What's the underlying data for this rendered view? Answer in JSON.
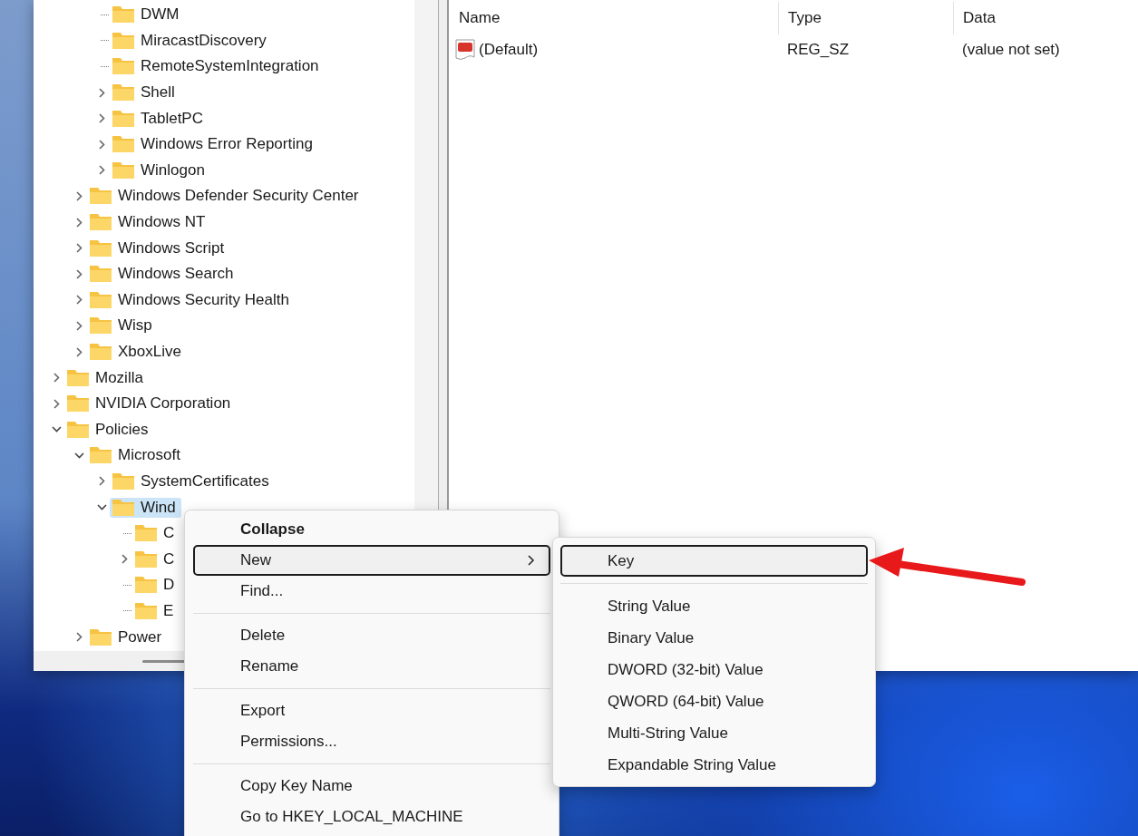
{
  "tree": {
    "items": [
      {
        "children": [
          {
            "children": [
              {
                "label": "DWM",
                "kind": "leaf",
                "selected": false
              },
              {
                "label": "MiracastDiscovery",
                "kind": "leaf",
                "selected": false
              },
              {
                "label": "RemoteSystemIntegration",
                "kind": "leaf",
                "selected": false
              },
              {
                "label": "Shell",
                "kind": "collapsed",
                "selected": false
              },
              {
                "label": "TabletPC",
                "kind": "collapsed",
                "selected": false
              },
              {
                "label": "Windows Error Reporting",
                "kind": "collapsed",
                "selected": false
              },
              {
                "label": "Winlogon",
                "kind": "collapsed",
                "selected": false
              }
            ]
          },
          {
            "label": "Windows Defender Security Center",
            "kind": "collapsed",
            "selected": false
          },
          {
            "label": "Windows NT",
            "kind": "collapsed",
            "selected": false
          },
          {
            "label": "Windows Script",
            "kind": "collapsed",
            "selected": false
          },
          {
            "label": "Windows Search",
            "kind": "collapsed",
            "selected": false
          },
          {
            "label": "Windows Security Health",
            "kind": "collapsed",
            "selected": false
          },
          {
            "label": "Wisp",
            "kind": "collapsed",
            "selected": false
          },
          {
            "label": "XboxLive",
            "kind": "collapsed",
            "selected": false
          }
        ]
      },
      {
        "label": "Mozilla",
        "kind": "collapsed",
        "selected": false
      },
      {
        "label": "NVIDIA Corporation",
        "kind": "collapsed",
        "selected": false
      },
      {
        "label": "Policies",
        "kind": "expanded",
        "selected": false,
        "children": [
          {
            "label": "Microsoft",
            "kind": "expanded",
            "selected": false,
            "children": [
              {
                "label": "SystemCertificates",
                "kind": "collapsed",
                "selected": false
              },
              {
                "label": "Wind",
                "kind": "expanded",
                "selected": true,
                "children": [
                  {
                    "label": "C",
                    "kind": "leaf",
                    "selected": false
                  },
                  {
                    "label": "C",
                    "kind": "collapsed",
                    "selected": false
                  },
                  {
                    "label": "D",
                    "kind": "leaf",
                    "selected": false
                  },
                  {
                    "label": "E",
                    "kind": "leaf",
                    "selected": false
                  }
                ]
              }
            ]
          },
          {
            "label": "Power",
            "kind": "collapsed",
            "selected": false
          }
        ]
      }
    ]
  },
  "values": {
    "columns": [
      "Name",
      "Type",
      "Data"
    ],
    "rows": [
      {
        "name": "(Default)",
        "type": "REG_SZ",
        "data": "(value not set)"
      }
    ]
  },
  "context_menu": {
    "groups": [
      [
        {
          "label": "Collapse",
          "default": true,
          "selected": false,
          "submenu": false
        },
        {
          "label": "New",
          "default": false,
          "selected": true,
          "submenu": true
        },
        {
          "label": "Find...",
          "default": false,
          "selected": false,
          "submenu": false
        }
      ],
      [
        {
          "label": "Delete",
          "default": false,
          "selected": false,
          "submenu": false
        },
        {
          "label": "Rename",
          "default": false,
          "selected": false,
          "submenu": false
        }
      ],
      [
        {
          "label": "Export",
          "default": false,
          "selected": false,
          "submenu": false
        },
        {
          "label": "Permissions...",
          "default": false,
          "selected": false,
          "submenu": false
        }
      ],
      [
        {
          "label": "Copy Key Name",
          "default": false,
          "selected": false,
          "submenu": false
        },
        {
          "label": "Go to HKEY_LOCAL_MACHINE",
          "default": false,
          "selected": false,
          "submenu": false
        }
      ]
    ]
  },
  "submenu": {
    "groups": [
      [
        {
          "label": "Key",
          "selected": true
        }
      ],
      [
        {
          "label": "String Value",
          "selected": false
        },
        {
          "label": "Binary Value",
          "selected": false
        },
        {
          "label": "DWORD (32-bit) Value",
          "selected": false
        },
        {
          "label": "QWORD (64-bit) Value",
          "selected": false
        },
        {
          "label": "Multi-String Value",
          "selected": false
        },
        {
          "label": "Expandable String Value",
          "selected": false
        }
      ]
    ]
  }
}
